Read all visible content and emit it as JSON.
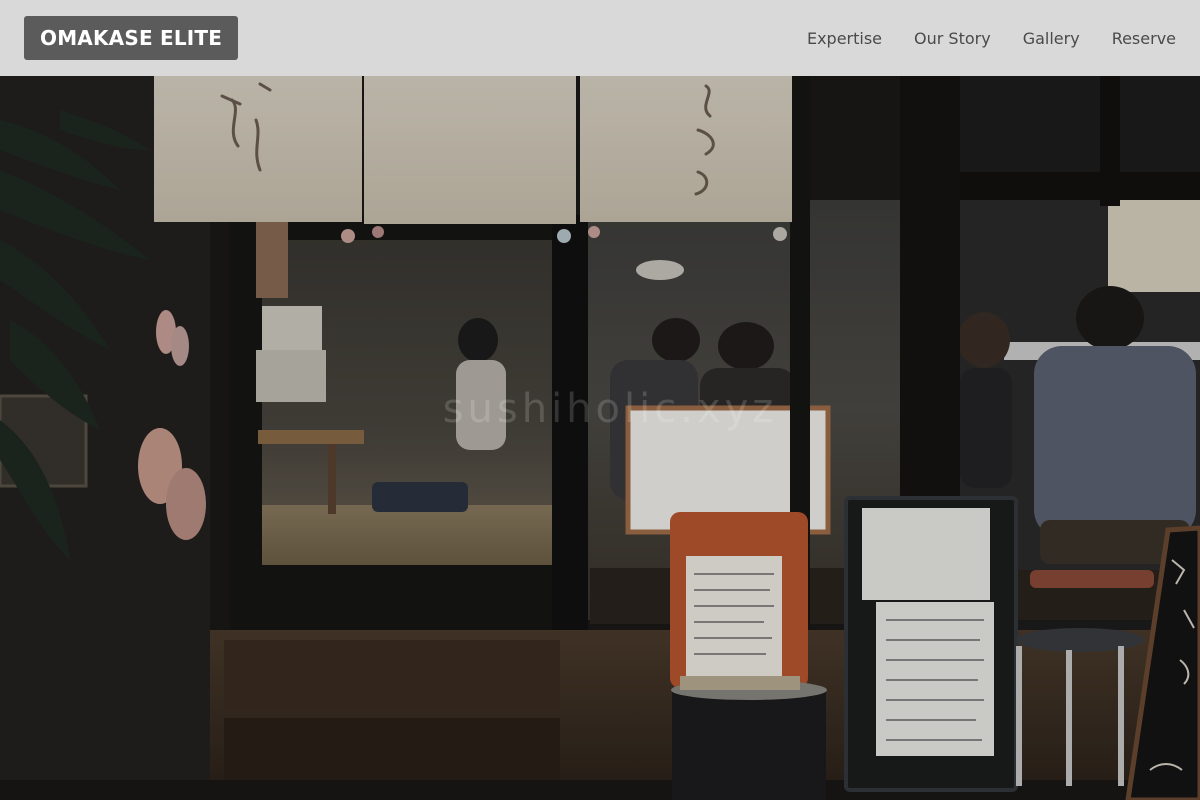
{
  "navbar": {
    "brand": "OMAKASE ELITE",
    "links": [
      {
        "label": "Expertise"
      },
      {
        "label": "Our Story"
      },
      {
        "label": "Gallery"
      },
      {
        "label": "Reserve"
      }
    ]
  },
  "hero": {
    "watermark": "sushiholic.xyz"
  },
  "colors": {
    "navbar_bg": "#e8e8e8",
    "brand_bg": "#5b5b5b",
    "brand_text": "#ffffff",
    "nav_link": "#4a4a4a",
    "hero_dark": "#151515"
  }
}
